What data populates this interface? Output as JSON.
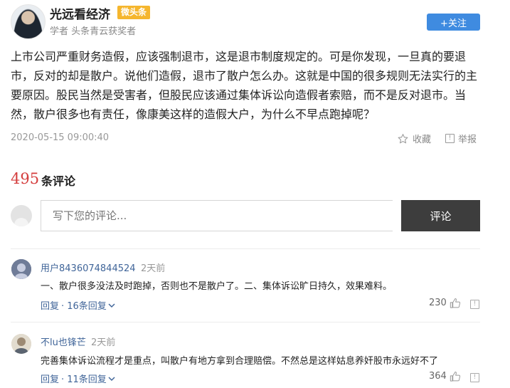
{
  "author": {
    "name": "光远看经济",
    "badge": "微头条",
    "desc": "学者 头条青云获奖者",
    "follow_label": "+关注"
  },
  "post": {
    "text": "上市公司严重财务造假，应该强制退市，这是退市制度规定的。可是你发现，一旦真的要退市，反对的却是散户。说他们造假，退市了散户怎么办。这就是中国的很多规则无法实行的主要原因。股民当然是受害者，但股民应该通过集体诉讼向造假者索赔，而不是反对退市。当然，散户很多也有责任，像康美这样的造假大户，为什么不早点跑掉呢？",
    "time": "2020-05-15 09:00:40",
    "favorite_label": "收藏",
    "report_label": "举报"
  },
  "comments_header": {
    "count": "495",
    "label": "条评论"
  },
  "comment_box": {
    "placeholder": "写下您的评论...",
    "submit_label": "评论"
  },
  "comments": [
    {
      "user": "用户8436074844524",
      "time": "2天前",
      "text": "一、散户很多没法及时跑掉，否则也不是散户了。二、集体诉讼旷日持久，效果难料。",
      "reply_label": "回复",
      "replies_label": "· 16条回复",
      "likes": "230"
    },
    {
      "user": "不lu也锋芒",
      "time": "2天前",
      "text": "完善集体诉讼流程才是重点，叫散户有地方拿到合理赔偿。不然总是这样姑息养奸股市永远好不了",
      "reply_label": "回复",
      "replies_label": "· 11条回复",
      "likes": "364"
    }
  ],
  "colors": {
    "accent": "#3f8be0",
    "count_red": "#d43d3d",
    "link_blue": "#406599",
    "badge": "#f5b62e"
  }
}
